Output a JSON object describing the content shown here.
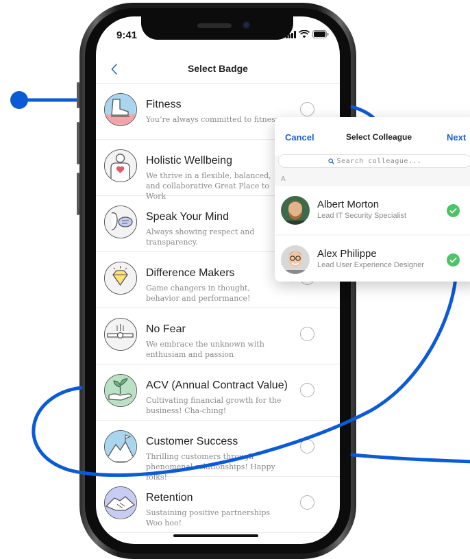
{
  "status": {
    "time": "9:41"
  },
  "nav": {
    "title": "Select Badge"
  },
  "badges": [
    {
      "name": "Fitness",
      "desc": "You’re always committed to fitness",
      "icon": "sneaker-icon"
    },
    {
      "name": "Holistic Wellbeing",
      "desc": "We thrive in a flexible, balanced, and collaborative Great Place to Work",
      "icon": "heart-body-icon"
    },
    {
      "name": "Speak Your Mind",
      "desc": "Always showing respect and transparency.",
      "icon": "speech-bubble-icon"
    },
    {
      "name": "Difference Makers",
      "desc": "Game changers in thought, behavior and performance!",
      "icon": "diamond-icon"
    },
    {
      "name": "No Fear",
      "desc": "We embrace the unknown with enthusiam and passion",
      "icon": "skydiver-icon"
    },
    {
      "name": "ACV (Annual Contract Value)",
      "desc": "Cultivating financial growth for the business! Cha-ching!",
      "icon": "plant-hand-icon"
    },
    {
      "name": "Customer Success",
      "desc": "Thrilling customers through phenomenal relationships! Happy folks!",
      "icon": "mountain-flag-icon"
    },
    {
      "name": "Retention",
      "desc": "Sustaining positive partnerships Woo hoo!",
      "icon": "handshake-icon"
    }
  ],
  "colleague_picker": {
    "cancel_label": "Cancel",
    "title": "Select Colleague",
    "next_label": "Next",
    "search_placeholder": "Search colleague...",
    "section_letter": "A",
    "colleagues": [
      {
        "name": "Albert Morton",
        "role": "Lead IT Security Specialist",
        "selected": true
      },
      {
        "name": "Alex Philippe",
        "role": "Lead User Experience Designer",
        "selected": true
      }
    ]
  },
  "colors": {
    "accent_blue": "#1f5fc9",
    "decor_blue": "#0b5bd6",
    "check_green": "#4cc466"
  }
}
